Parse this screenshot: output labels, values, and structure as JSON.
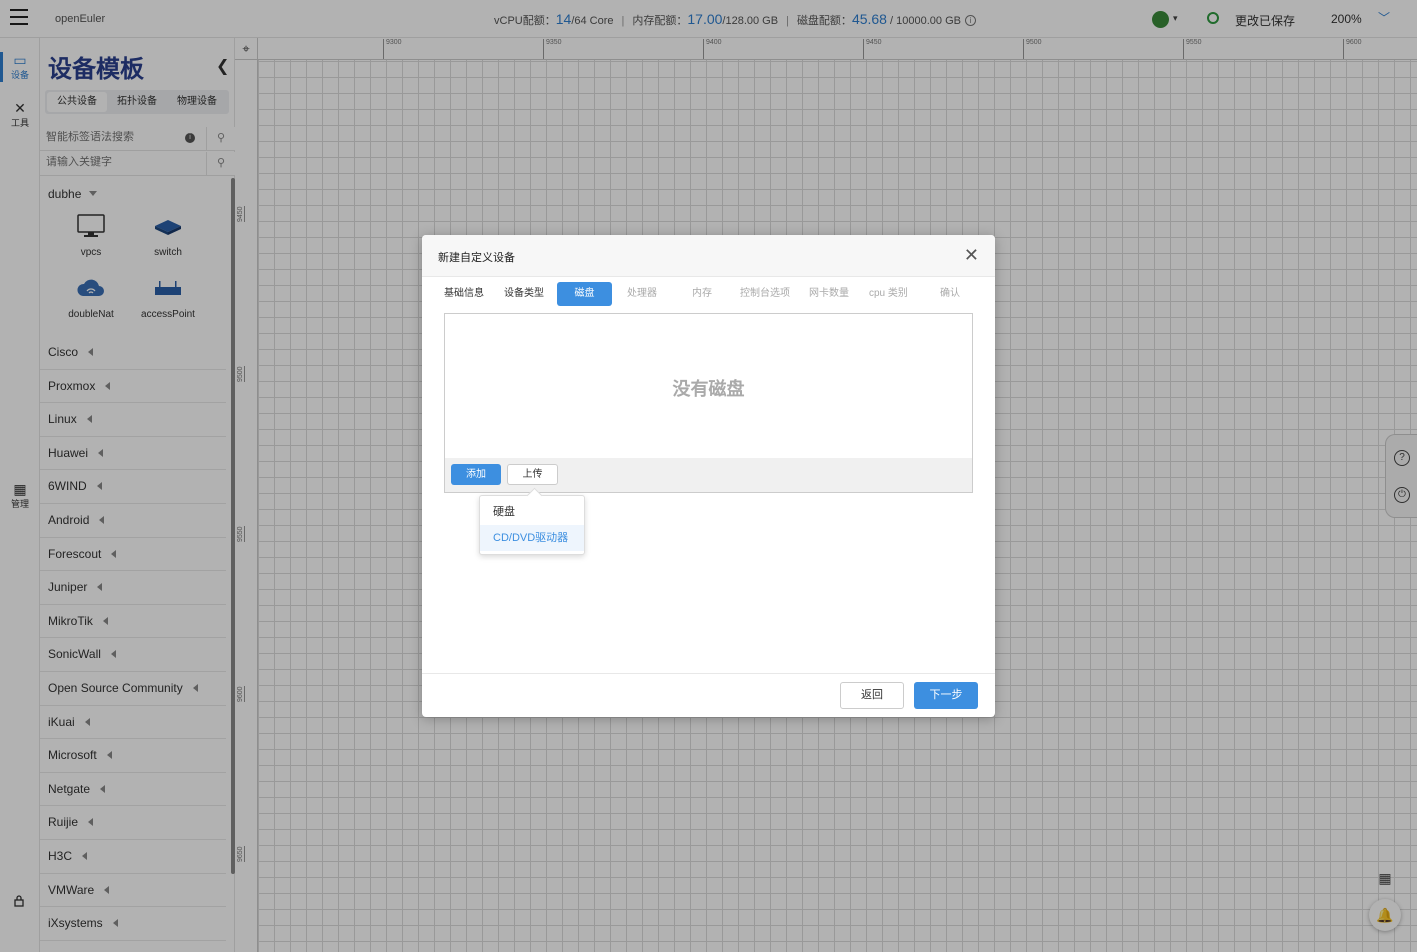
{
  "topbar": {
    "app_name": "openEuler",
    "vcpu_label": "vCPU配额：",
    "vcpu_used": "14",
    "vcpu_total": "/64 Core",
    "mem_label": "内存配额：",
    "mem_used": "17.00",
    "mem_total": "/128.00 GB",
    "disk_label": "磁盘配额：",
    "disk_used": "45.68",
    "disk_total": " / 10000.00 GB",
    "save_status": "更改已保存",
    "zoom": "200%",
    "icons": {
      "menu": "hamburger-icon",
      "avatar": "user-avatar",
      "save": "refresh-icon",
      "zoom_caret": "chevron-down-icon"
    }
  },
  "rail": {
    "devices": "设备",
    "tools": "工具",
    "manage": "管理"
  },
  "panel": {
    "title": "设备模板",
    "tabs": [
      "公共设备",
      "拓扑设备",
      "物理设备"
    ],
    "smart_search_placeholder": "智能标签语法搜索",
    "keyword_placeholder": "请输入关键字",
    "open_group": "dubhe",
    "devices": [
      {
        "label": "vpcs",
        "icon": "monitor-icon"
      },
      {
        "label": "switch",
        "icon": "switch-icon"
      },
      {
        "label": "doubleNat",
        "icon": "cloud-icon"
      },
      {
        "label": "accessPoint",
        "icon": "access-point-icon"
      }
    ],
    "vendors": [
      "Cisco",
      "Proxmox",
      "Linux",
      "Huawei",
      "6WIND",
      "Android",
      "Forescout",
      "Juniper",
      "MikroTik",
      "SonicWall",
      "Open Source Community",
      "iKuai",
      "Microsoft",
      "Netgate",
      "Ruijie",
      "H3C",
      "VMWare",
      "iXsystems"
    ]
  },
  "ruler": {
    "top": [
      "9300",
      "9350",
      "9400",
      "9450",
      "9500",
      "9550",
      "9600"
    ],
    "left": [
      "9450",
      "9500",
      "9550",
      "9600",
      "9650"
    ]
  },
  "modal": {
    "title": "新建自定义设备",
    "steps": [
      "基础信息",
      "设备类型",
      "磁盘",
      "处理器",
      "内存",
      "控制台选项",
      "网卡数量",
      "cpu 类别",
      "确认"
    ],
    "active_step": "磁盘",
    "empty_message": "没有磁盘",
    "add_button": "添加",
    "upload_button": "上传",
    "dropdown": [
      "硬盘",
      "CD/DVD驱动器"
    ],
    "back_button": "返回",
    "next_button": "下一步"
  },
  "colors": {
    "accent": "#3d8fe0",
    "title": "#2a3f8f"
  }
}
